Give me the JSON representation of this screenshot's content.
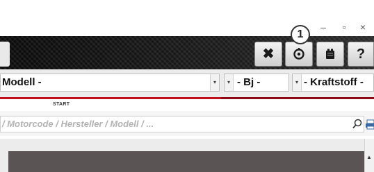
{
  "window": {
    "minimize_glyph": "–",
    "maximize_glyph": "▫",
    "close_glyph": "×"
  },
  "callout": {
    "number": "1"
  },
  "toolbar": {
    "buttons": [
      {
        "icon": "tools-icon",
        "glyph": "✖"
      },
      {
        "icon": "target-settings-icon"
      },
      {
        "icon": "battery-icon"
      },
      {
        "icon": "help-icon",
        "glyph": "?"
      }
    ]
  },
  "filters": {
    "model_label": "Modell -",
    "year_label": "- Bj -",
    "fuel_label": "- Kraftstoff -",
    "dropdown_glyph": "▾"
  },
  "tabs": {
    "start_label": "START"
  },
  "search": {
    "placeholder": "/ Motorcode / Hersteller / Modell / ..."
  },
  "scroll": {
    "up_glyph": "▲"
  },
  "colors": {
    "accent_red": "#c0101b",
    "toolbar_dark": "#111111"
  }
}
